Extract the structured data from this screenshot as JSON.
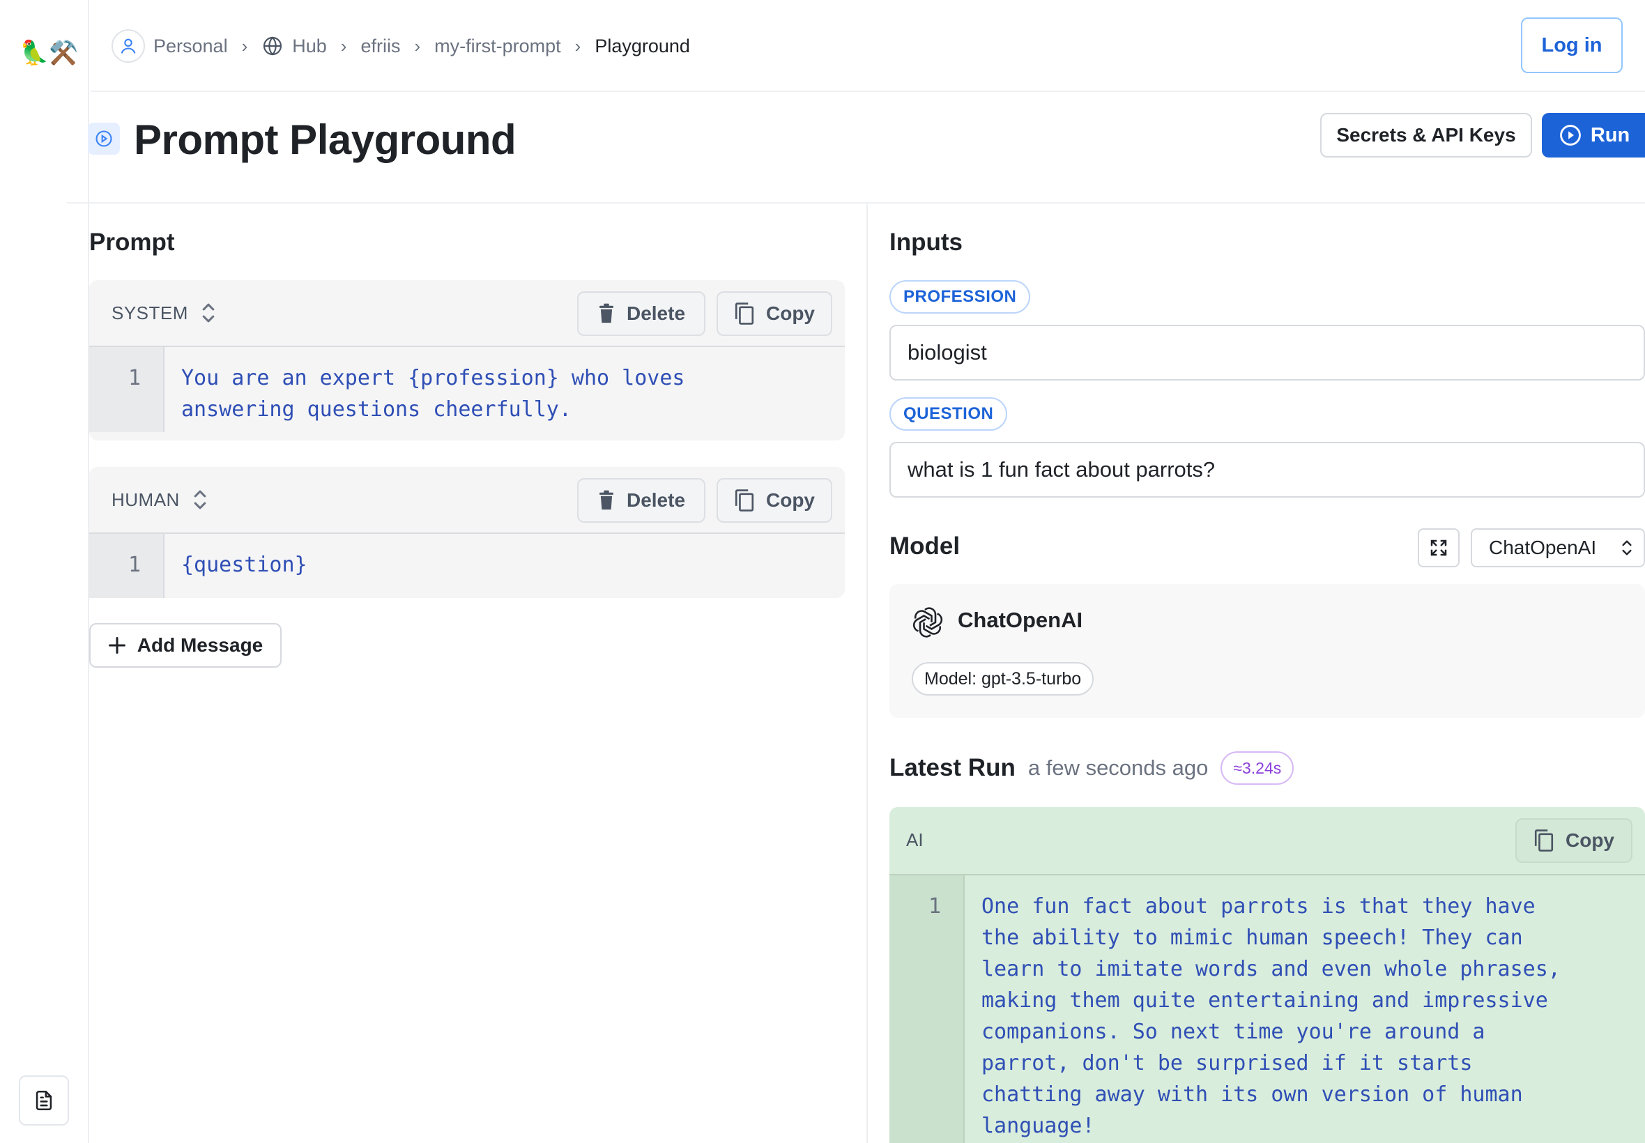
{
  "app": {
    "logo": "🦜⚒️"
  },
  "breadcrumb": {
    "items": [
      "Personal",
      "Hub",
      "efriis",
      "my-first-prompt",
      "Playground"
    ],
    "separator": "›"
  },
  "auth": {
    "login_label": "Log in"
  },
  "header": {
    "title": "Prompt Playground",
    "secrets_label": "Secrets & API Keys",
    "run_label": "Run"
  },
  "prompt": {
    "title": "Prompt",
    "messages": [
      {
        "role": "SYSTEM",
        "delete_label": "Delete",
        "copy_label": "Copy",
        "line_number": "1",
        "text": "You are an expert {profession} who loves\nanswering questions cheerfully."
      },
      {
        "role": "HUMAN",
        "delete_label": "Delete",
        "copy_label": "Copy",
        "line_number": "1",
        "text": "{question}"
      }
    ],
    "add_message_label": "Add Message"
  },
  "inputs": {
    "title": "Inputs",
    "variables": [
      {
        "name": "PROFESSION",
        "value": "biologist"
      },
      {
        "name": "QUESTION",
        "value": "what is 1 fun fact about parrots?"
      }
    ]
  },
  "model": {
    "title": "Model",
    "selected": "ChatOpenAI",
    "card_name": "ChatOpenAI",
    "badge": "Model: gpt-3.5-turbo"
  },
  "latest_run": {
    "title": "Latest Run",
    "when": "a few seconds ago",
    "duration": "≈3.24s",
    "role": "AI",
    "copy_label": "Copy",
    "line_number": "1",
    "text": "One fun fact about parrots is that they have\nthe ability to mimic human speech! They can\nlearn to imitate words and even whole phrases,\nmaking them quite entertaining and impressive\ncompanions. So next time you're around a\nparrot, don't be surprised if it starts\nchatting away with its own version of human\nlanguage!"
  },
  "colors": {
    "accent": "#1d63d8",
    "ai_background": "#d9eddc",
    "duration_purple": "#8b3fd9"
  },
  "icons": [
    "user-icon",
    "globe-icon",
    "play-circle-icon",
    "trash-icon",
    "copy-icon",
    "plus-icon",
    "expand-icon",
    "chevron-updown-icon",
    "openai-logo-icon",
    "document-icon"
  ]
}
